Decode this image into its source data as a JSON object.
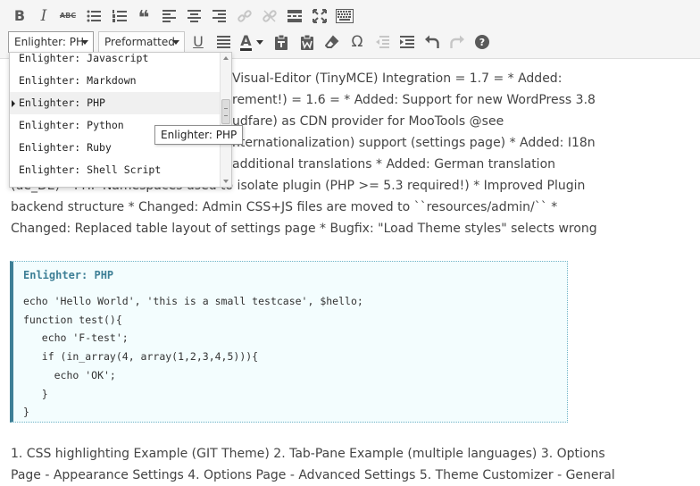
{
  "toolbar": {
    "row1": [
      {
        "name": "bold-button",
        "icon": "bold-icon",
        "glyph": "B"
      },
      {
        "name": "italic-button",
        "icon": "italic-icon",
        "glyph": "I"
      },
      {
        "name": "strikethrough-button",
        "icon": "strikethrough-icon",
        "glyph": "ABC"
      },
      {
        "name": "bullet-list-button",
        "icon": "bullet-list-icon"
      },
      {
        "name": "numbered-list-button",
        "icon": "numbered-list-icon"
      },
      {
        "name": "blockquote-button",
        "icon": "blockquote-icon",
        "glyph": "❝"
      },
      {
        "name": "align-left-button",
        "icon": "align-left-icon"
      },
      {
        "name": "align-center-button",
        "icon": "align-center-icon"
      },
      {
        "name": "align-right-button",
        "icon": "align-right-icon"
      },
      {
        "name": "insert-link-button",
        "icon": "link-icon",
        "disabled": true
      },
      {
        "name": "remove-link-button",
        "icon": "unlink-icon",
        "disabled": true
      },
      {
        "name": "read-more-button",
        "icon": "read-more-icon"
      },
      {
        "name": "fullscreen-button",
        "icon": "fullscreen-icon"
      },
      {
        "name": "toolbar-toggle-button",
        "icon": "keyboard-icon"
      }
    ],
    "enlighter_select_value": "Enlighter: PH",
    "format_select_value": "Preformatted",
    "row2": [
      {
        "name": "underline-button",
        "icon": "underline-icon",
        "glyph": "U"
      },
      {
        "name": "justify-button",
        "icon": "justify-icon"
      },
      {
        "name": "text-color-button",
        "icon": "text-color-icon",
        "glyph": "A"
      },
      {
        "name": "paste-as-text-button",
        "icon": "paste-text-icon"
      },
      {
        "name": "paste-word-button",
        "icon": "paste-word-icon"
      },
      {
        "name": "clear-formatting-button",
        "icon": "eraser-icon"
      },
      {
        "name": "special-character-button",
        "icon": "omega-icon",
        "glyph": "Ω"
      },
      {
        "name": "outdent-button",
        "icon": "outdent-icon",
        "disabled": true
      },
      {
        "name": "indent-button",
        "icon": "indent-icon"
      },
      {
        "name": "undo-button",
        "icon": "undo-icon"
      },
      {
        "name": "redo-button",
        "icon": "redo-icon",
        "disabled": true
      },
      {
        "name": "help-button",
        "icon": "help-icon",
        "glyph": "?"
      }
    ]
  },
  "dropdown": {
    "items": [
      {
        "label": "Enlighter: Javascript",
        "selected": false
      },
      {
        "label": "Enlighter: Markdown",
        "selected": false
      },
      {
        "label": "Enlighter: PHP",
        "selected": true
      },
      {
        "label": "Enlighter: Python",
        "selected": false
      },
      {
        "label": "Enlighter: Ruby",
        "selected": false
      },
      {
        "label": "Enlighter: Shell Script",
        "selected": false
      }
    ],
    "tooltip": "Enlighter: PHP"
  },
  "content": {
    "paragraph_lines": [
      "Visual-Editor (TinyMCE) Integration = 1.7 = * Added:",
      "rement!) = 1.6 = * Added: Support for new WordPress 3.8",
      "udfare) as CDN provider for MooTools @see",
      "nternationalization) support (settings page) * Added: I18n",
      "additional translations * Added: German translation",
      "(de_DE) * PHP Namespaces used to isolate plugin (PHP >= 5.3 required!) * Improved Plugin",
      "backend structure * Changed: Admin CSS+JS files are moved to ``resources/admin/`` *",
      "Changed: Replaced table layout of settings page * Bugfix: \"Load Theme styles\" selects wrong"
    ],
    "code_block": {
      "language_label": "Enlighter: PHP",
      "lines": [
        "echo 'Hello World', 'this is a small testcase', $hello;",
        "function test(){",
        "   echo 'F-test';",
        "   if (in_array(4, array(1,2,3,4,5))){",
        "     echo 'OK';",
        "   }",
        "}"
      ]
    },
    "bottom_lines": [
      "1. CSS highlighting Example (GIT Theme) 2. Tab-Pane Example (multiple languages) 3. Options",
      "Page - Appearance Settings 4. Options Page - Advanced Settings 5. Theme Customizer - General"
    ]
  },
  "colors": {
    "code_accent": "#3e7f96",
    "code_background": "#f3fdfe",
    "toolbar_background": "#f5f5f5"
  }
}
